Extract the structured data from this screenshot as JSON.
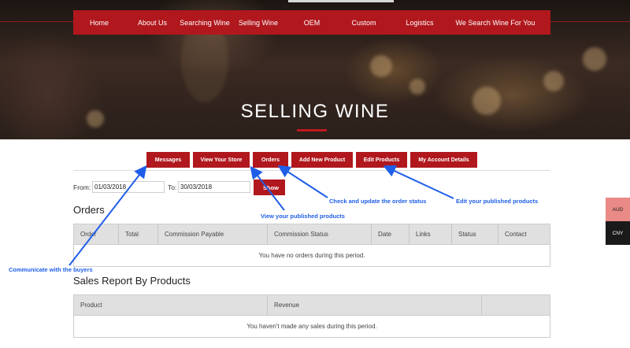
{
  "nav": {
    "items": [
      "Home",
      "About Us",
      "Searching Wine",
      "Selling Wine",
      "OEM",
      "Custom",
      "Logistics",
      "We Search Wine For You"
    ]
  },
  "hero": {
    "title": "SELLING WINE"
  },
  "account_buttons": [
    "Messages",
    "View Your Store",
    "Orders",
    "Add New Product",
    "Edit Products",
    "My Account Details"
  ],
  "filter": {
    "from_label": "From:",
    "from_value": "01/03/2018",
    "to_label": "To:",
    "to_value": "30/03/2018",
    "show_label": "Show"
  },
  "orders": {
    "title": "Orders",
    "columns": [
      "Order",
      "Total",
      "Commission Payable",
      "Commission Status",
      "Date",
      "Links",
      "Status",
      "Contact"
    ],
    "empty_message": "You have no orders during this period."
  },
  "sales_report": {
    "title": "Sales Report By Products",
    "columns": [
      "Product",
      "Revenue",
      ""
    ],
    "empty_message": "You haven't made any sales during this period."
  },
  "currency": {
    "options": [
      "AUD",
      "CNY"
    ],
    "colors": {
      "AUD": "#e98a86",
      "CNY": "#1a1a1a"
    }
  },
  "annotations": {
    "messages": "Communicate with the buyers",
    "view_store": "View your published products",
    "orders": "Check and update the order status",
    "edit_products": "Edit your published products"
  },
  "colors": {
    "brand_red": "#b0181d",
    "annotation_blue": "#1f5ee8",
    "table_header": "#e0e0e0"
  }
}
